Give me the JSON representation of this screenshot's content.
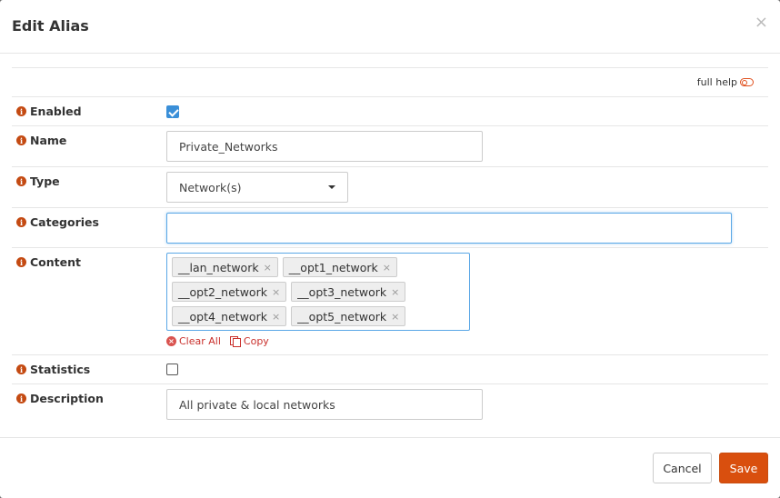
{
  "modal": {
    "title": "Edit Alias",
    "close_glyph": "×",
    "full_help_label": "full help"
  },
  "fields": {
    "enabled": {
      "label": "Enabled",
      "checked": true
    },
    "name": {
      "label": "Name",
      "value": "Private_Networks"
    },
    "type": {
      "label": "Type",
      "value": "Network(s)"
    },
    "categories": {
      "label": "Categories",
      "value": ""
    },
    "content": {
      "label": "Content",
      "tags": [
        "__lan_network",
        "__opt1_network",
        "__opt2_network",
        "__opt3_network",
        "__opt4_network",
        "__opt5_network"
      ],
      "clear_all_label": "Clear All",
      "copy_label": "Copy"
    },
    "statistics": {
      "label": "Statistics",
      "checked": false
    },
    "description": {
      "label": "Description",
      "value": "All private & local networks"
    }
  },
  "footer": {
    "cancel_label": "Cancel",
    "save_label": "Save"
  },
  "colors": {
    "accent": "#d94f0e",
    "info_icon": "#c44a12",
    "focus": "#5aa7e6",
    "checkbox": "#3a8fd8",
    "danger": "#c9302c"
  },
  "icons": {
    "info": "info-circle-icon",
    "close": "close-icon",
    "toggle": "toggle-off-icon",
    "tag_remove": "times-icon",
    "clear_all": "times-circle-icon",
    "copy": "copy-icon",
    "caret": "caret-down-icon"
  }
}
